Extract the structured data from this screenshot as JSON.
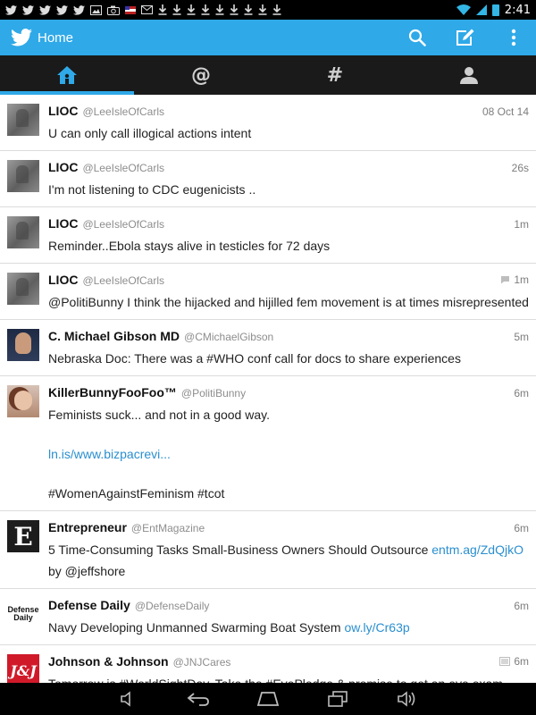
{
  "status_bar": {
    "time": "2:41",
    "left_icons": [
      "twitter-icon",
      "twitter-icon",
      "twitter-icon",
      "twitter-icon",
      "twitter-icon",
      "image-icon",
      "camera-icon",
      "flag-icon",
      "gmail-icon",
      "download-icon",
      "download-icon",
      "download-icon",
      "download-icon",
      "download-icon",
      "download-icon",
      "download-icon",
      "download-icon",
      "download-icon"
    ]
  },
  "header": {
    "title": "Home"
  },
  "tabs": [
    {
      "icon": "home-icon",
      "active": true
    },
    {
      "glyph": "@",
      "icon": "mentions-icon",
      "active": false
    },
    {
      "glyph": "#",
      "icon": "discover-icon",
      "active": false
    },
    {
      "icon": "profile-icon",
      "active": false
    }
  ],
  "tweets": [
    {
      "name": "LIOC",
      "handle": "@LeeIsleOfCarls",
      "time": "08 Oct 14",
      "text": "U can only call illogical actions intent"
    },
    {
      "name": "LIOC",
      "handle": "@LeeIsleOfCarls",
      "time": "26s",
      "text": "I'm not listening to CDC eugenicists .."
    },
    {
      "name": "LIOC",
      "handle": "@LeeIsleOfCarls",
      "time": "1m",
      "text": "Reminder..Ebola stays alive in testicles for 72 days"
    },
    {
      "name": "LIOC",
      "handle": "@LeeIsleOfCarls",
      "time": "1m",
      "text": "@PolitiBunny I think the hijacked and hijilled fem movement is at times misrepresented"
    },
    {
      "name": "C. Michael Gibson MD",
      "handle": "@CMichaelGibson",
      "time": "5m",
      "text": "Nebraska Doc: There was a #WHO conf call for docs to share experiences"
    },
    {
      "name": "KillerBunnyFooFoo™",
      "handle": "@PolitiBunny",
      "time": "6m",
      "text": "Feminists suck... and not in a good way.",
      "link": "ln.is/www.bizpacrevi...",
      "hashtags": "#WomenAgainstFeminism #tcot"
    },
    {
      "name": "Entrepreneur",
      "handle": "@EntMagazine",
      "time": "6m",
      "text": "5 Time-Consuming Tasks Small-Business Owners Should Outsource",
      "link": "entm.ag/ZdQjkO",
      "text2": "by @jeffshore"
    },
    {
      "name": "Defense Daily",
      "handle": "@DefenseDaily",
      "time": "6m",
      "text": "Navy Developing Unmanned Swarming Boat System",
      "link": "ow.ly/Cr63p",
      "avatar_text": [
        "Defense",
        "Daily"
      ]
    },
    {
      "name": "Johnson & Johnson",
      "handle": "@JNJCares",
      "time": "6m",
      "text": "Tomorrow is #WorldSightDay. Take the #EyePledge & promise to get an eye exam.",
      "avatar_text": "J&J"
    }
  ],
  "colors": {
    "action_bar": "#2fa9e8",
    "tab_bar": "#1a1a1a",
    "link": "#2a8fcf",
    "status_bar": "#000000"
  }
}
